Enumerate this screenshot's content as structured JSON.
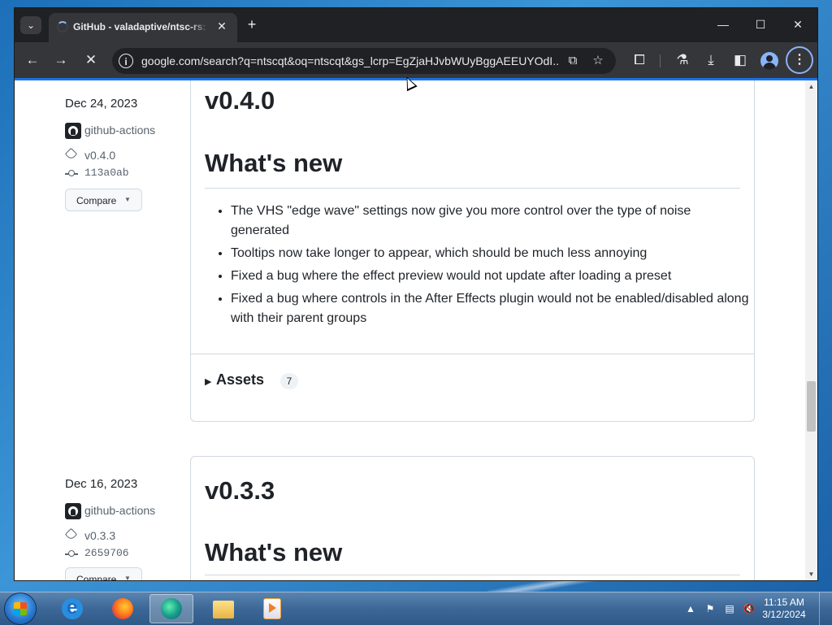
{
  "browser": {
    "tab": {
      "title": "GitHub - valadaptive/ntsc-rs: A"
    },
    "url": "google.com/search?q=ntscqt&oq=ntscqt&gs_lcrp=EgZjaHJvbWUyBggAEEUYOdI..."
  },
  "releases": [
    {
      "date": "Dec 24, 2023",
      "author": "github-actions",
      "tag": "v0.4.0",
      "commit": "113a0ab",
      "compare_label": "Compare",
      "title": "v0.4.0",
      "section_heading": "What's new",
      "notes": [
        "The VHS \"edge wave\" settings now give you more control over the type of noise generated",
        "Tooltips now take longer to appear, which should be much less annoying",
        "Fixed a bug where the effect preview would not update after loading a preset",
        "Fixed a bug where controls in the After Effects plugin would not be enabled/disabled along with their parent groups"
      ],
      "assets_label": "Assets",
      "assets_count": "7"
    },
    {
      "date": "Dec 16, 2023",
      "author": "github-actions",
      "tag": "v0.3.3",
      "commit": "2659706",
      "compare_label": "Compare",
      "title": "v0.3.3",
      "section_heading": "What's new"
    }
  ],
  "taskbar": {
    "clock_time": "11:15 AM",
    "clock_date": "3/12/2024"
  }
}
